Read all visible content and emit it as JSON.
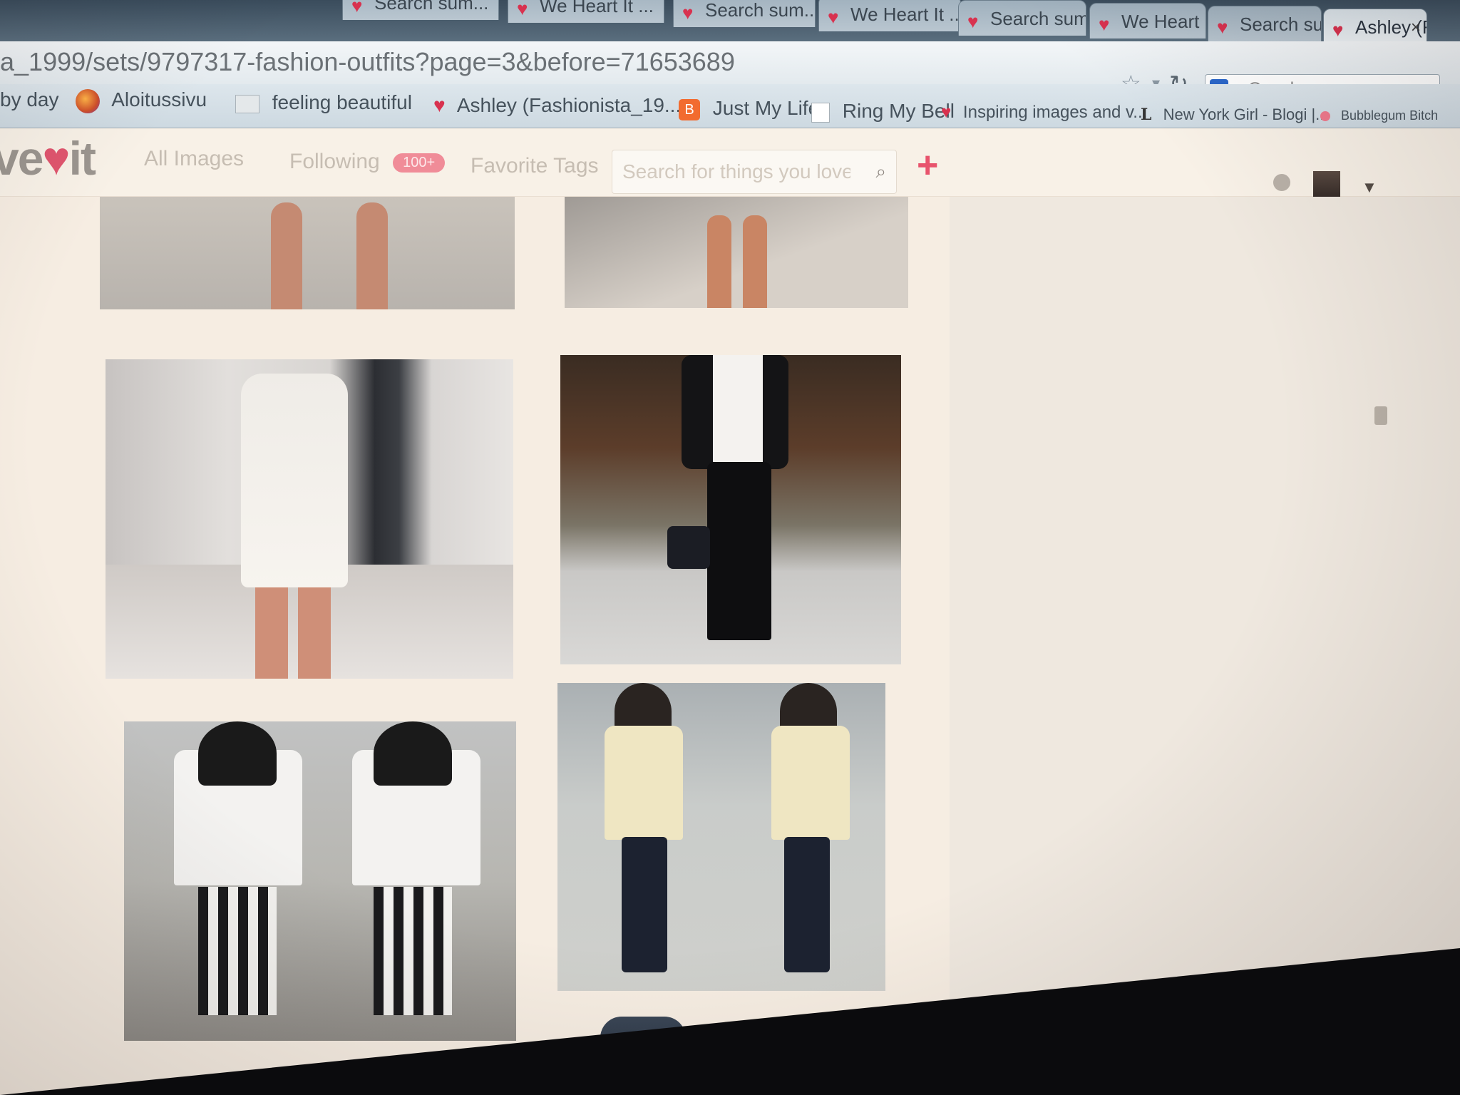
{
  "browser": {
    "tabs": [
      {
        "label": "Search sum...",
        "active": false
      },
      {
        "label": "We Heart It ...",
        "active": false
      },
      {
        "label": "Search sum...",
        "active": false
      },
      {
        "label": "We Heart It ...",
        "active": false
      },
      {
        "label": "Search sum...",
        "active": false
      },
      {
        "label": "We Heart It ...",
        "active": false
      },
      {
        "label": "Search sum...",
        "active": false
      },
      {
        "label": "Ashley (F...",
        "active": true
      }
    ],
    "url": "a_1999/sets/9797317-fashion-outfits?page=3&before=71653689",
    "search_engine_label": "Google",
    "bookmarks": [
      {
        "label": "by day",
        "icon": "none"
      },
      {
        "label": "Aloitussivu",
        "icon": "firefox-icon"
      },
      {
        "label": "feeling beautiful",
        "icon": "image-icon"
      },
      {
        "label": "Ashley (Fashionista_19...",
        "icon": "heart-icon"
      },
      {
        "label": "Just My Life",
        "icon": "blogger-icon"
      },
      {
        "label": "Ring My Bell",
        "icon": "blank-page-icon"
      },
      {
        "label": "Inspiring images and v...",
        "icon": "heart-icon"
      },
      {
        "label": "New York Girl - Blogi |...",
        "icon": "letter-l-icon"
      },
      {
        "label": "Bubblegum Bitch",
        "icon": "dot-icon"
      }
    ]
  },
  "site": {
    "logo_left": "ve",
    "logo_right": "it",
    "nav": {
      "all_images": "All Images",
      "following": "Following",
      "following_badge": "100+",
      "favorite_tags": "Favorite Tags"
    },
    "search_placeholder": "Search for things you love",
    "add_symbol": "+",
    "user_menu_symbol": "▼"
  },
  "colors": {
    "brand_pink": "#e0556e",
    "page_background": "#f6ede2",
    "tab_heart": "#d8324f"
  }
}
